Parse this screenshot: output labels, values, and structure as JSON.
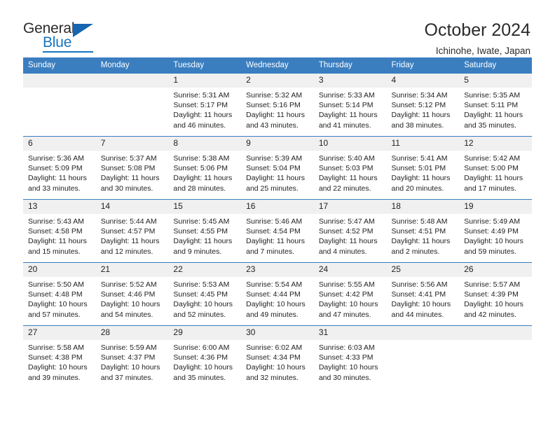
{
  "brand": {
    "name_part1": "General",
    "name_part2": "Blue",
    "accent_color": "#1874bd"
  },
  "header": {
    "title": "October 2024",
    "subtitle": "Ichinohe, Iwate, Japan"
  },
  "calendar": {
    "header_bg": "#3a7ec0",
    "daynum_bg": "#f0f0f0",
    "weekday_headers": [
      "Sunday",
      "Monday",
      "Tuesday",
      "Wednesday",
      "Thursday",
      "Friday",
      "Saturday"
    ],
    "weeks": [
      [
        {
          "day": "",
          "sunrise": "",
          "sunset": "",
          "daylight_line1": "",
          "daylight_line2": ""
        },
        {
          "day": "",
          "sunrise": "",
          "sunset": "",
          "daylight_line1": "",
          "daylight_line2": ""
        },
        {
          "day": "1",
          "sunrise": "Sunrise: 5:31 AM",
          "sunset": "Sunset: 5:17 PM",
          "daylight_line1": "Daylight: 11 hours",
          "daylight_line2": "and 46 minutes."
        },
        {
          "day": "2",
          "sunrise": "Sunrise: 5:32 AM",
          "sunset": "Sunset: 5:16 PM",
          "daylight_line1": "Daylight: 11 hours",
          "daylight_line2": "and 43 minutes."
        },
        {
          "day": "3",
          "sunrise": "Sunrise: 5:33 AM",
          "sunset": "Sunset: 5:14 PM",
          "daylight_line1": "Daylight: 11 hours",
          "daylight_line2": "and 41 minutes."
        },
        {
          "day": "4",
          "sunrise": "Sunrise: 5:34 AM",
          "sunset": "Sunset: 5:12 PM",
          "daylight_line1": "Daylight: 11 hours",
          "daylight_line2": "and 38 minutes."
        },
        {
          "day": "5",
          "sunrise": "Sunrise: 5:35 AM",
          "sunset": "Sunset: 5:11 PM",
          "daylight_line1": "Daylight: 11 hours",
          "daylight_line2": "and 35 minutes."
        }
      ],
      [
        {
          "day": "6",
          "sunrise": "Sunrise: 5:36 AM",
          "sunset": "Sunset: 5:09 PM",
          "daylight_line1": "Daylight: 11 hours",
          "daylight_line2": "and 33 minutes."
        },
        {
          "day": "7",
          "sunrise": "Sunrise: 5:37 AM",
          "sunset": "Sunset: 5:08 PM",
          "daylight_line1": "Daylight: 11 hours",
          "daylight_line2": "and 30 minutes."
        },
        {
          "day": "8",
          "sunrise": "Sunrise: 5:38 AM",
          "sunset": "Sunset: 5:06 PM",
          "daylight_line1": "Daylight: 11 hours",
          "daylight_line2": "and 28 minutes."
        },
        {
          "day": "9",
          "sunrise": "Sunrise: 5:39 AM",
          "sunset": "Sunset: 5:04 PM",
          "daylight_line1": "Daylight: 11 hours",
          "daylight_line2": "and 25 minutes."
        },
        {
          "day": "10",
          "sunrise": "Sunrise: 5:40 AM",
          "sunset": "Sunset: 5:03 PM",
          "daylight_line1": "Daylight: 11 hours",
          "daylight_line2": "and 22 minutes."
        },
        {
          "day": "11",
          "sunrise": "Sunrise: 5:41 AM",
          "sunset": "Sunset: 5:01 PM",
          "daylight_line1": "Daylight: 11 hours",
          "daylight_line2": "and 20 minutes."
        },
        {
          "day": "12",
          "sunrise": "Sunrise: 5:42 AM",
          "sunset": "Sunset: 5:00 PM",
          "daylight_line1": "Daylight: 11 hours",
          "daylight_line2": "and 17 minutes."
        }
      ],
      [
        {
          "day": "13",
          "sunrise": "Sunrise: 5:43 AM",
          "sunset": "Sunset: 4:58 PM",
          "daylight_line1": "Daylight: 11 hours",
          "daylight_line2": "and 15 minutes."
        },
        {
          "day": "14",
          "sunrise": "Sunrise: 5:44 AM",
          "sunset": "Sunset: 4:57 PM",
          "daylight_line1": "Daylight: 11 hours",
          "daylight_line2": "and 12 minutes."
        },
        {
          "day": "15",
          "sunrise": "Sunrise: 5:45 AM",
          "sunset": "Sunset: 4:55 PM",
          "daylight_line1": "Daylight: 11 hours",
          "daylight_line2": "and 9 minutes."
        },
        {
          "day": "16",
          "sunrise": "Sunrise: 5:46 AM",
          "sunset": "Sunset: 4:54 PM",
          "daylight_line1": "Daylight: 11 hours",
          "daylight_line2": "and 7 minutes."
        },
        {
          "day": "17",
          "sunrise": "Sunrise: 5:47 AM",
          "sunset": "Sunset: 4:52 PM",
          "daylight_line1": "Daylight: 11 hours",
          "daylight_line2": "and 4 minutes."
        },
        {
          "day": "18",
          "sunrise": "Sunrise: 5:48 AM",
          "sunset": "Sunset: 4:51 PM",
          "daylight_line1": "Daylight: 11 hours",
          "daylight_line2": "and 2 minutes."
        },
        {
          "day": "19",
          "sunrise": "Sunrise: 5:49 AM",
          "sunset": "Sunset: 4:49 PM",
          "daylight_line1": "Daylight: 10 hours",
          "daylight_line2": "and 59 minutes."
        }
      ],
      [
        {
          "day": "20",
          "sunrise": "Sunrise: 5:50 AM",
          "sunset": "Sunset: 4:48 PM",
          "daylight_line1": "Daylight: 10 hours",
          "daylight_line2": "and 57 minutes."
        },
        {
          "day": "21",
          "sunrise": "Sunrise: 5:52 AM",
          "sunset": "Sunset: 4:46 PM",
          "daylight_line1": "Daylight: 10 hours",
          "daylight_line2": "and 54 minutes."
        },
        {
          "day": "22",
          "sunrise": "Sunrise: 5:53 AM",
          "sunset": "Sunset: 4:45 PM",
          "daylight_line1": "Daylight: 10 hours",
          "daylight_line2": "and 52 minutes."
        },
        {
          "day": "23",
          "sunrise": "Sunrise: 5:54 AM",
          "sunset": "Sunset: 4:44 PM",
          "daylight_line1": "Daylight: 10 hours",
          "daylight_line2": "and 49 minutes."
        },
        {
          "day": "24",
          "sunrise": "Sunrise: 5:55 AM",
          "sunset": "Sunset: 4:42 PM",
          "daylight_line1": "Daylight: 10 hours",
          "daylight_line2": "and 47 minutes."
        },
        {
          "day": "25",
          "sunrise": "Sunrise: 5:56 AM",
          "sunset": "Sunset: 4:41 PM",
          "daylight_line1": "Daylight: 10 hours",
          "daylight_line2": "and 44 minutes."
        },
        {
          "day": "26",
          "sunrise": "Sunrise: 5:57 AM",
          "sunset": "Sunset: 4:39 PM",
          "daylight_line1": "Daylight: 10 hours",
          "daylight_line2": "and 42 minutes."
        }
      ],
      [
        {
          "day": "27",
          "sunrise": "Sunrise: 5:58 AM",
          "sunset": "Sunset: 4:38 PM",
          "daylight_line1": "Daylight: 10 hours",
          "daylight_line2": "and 39 minutes."
        },
        {
          "day": "28",
          "sunrise": "Sunrise: 5:59 AM",
          "sunset": "Sunset: 4:37 PM",
          "daylight_line1": "Daylight: 10 hours",
          "daylight_line2": "and 37 minutes."
        },
        {
          "day": "29",
          "sunrise": "Sunrise: 6:00 AM",
          "sunset": "Sunset: 4:36 PM",
          "daylight_line1": "Daylight: 10 hours",
          "daylight_line2": "and 35 minutes."
        },
        {
          "day": "30",
          "sunrise": "Sunrise: 6:02 AM",
          "sunset": "Sunset: 4:34 PM",
          "daylight_line1": "Daylight: 10 hours",
          "daylight_line2": "and 32 minutes."
        },
        {
          "day": "31",
          "sunrise": "Sunrise: 6:03 AM",
          "sunset": "Sunset: 4:33 PM",
          "daylight_line1": "Daylight: 10 hours",
          "daylight_line2": "and 30 minutes."
        },
        {
          "day": "",
          "sunrise": "",
          "sunset": "",
          "daylight_line1": "",
          "daylight_line2": ""
        },
        {
          "day": "",
          "sunrise": "",
          "sunset": "",
          "daylight_line1": "",
          "daylight_line2": ""
        }
      ]
    ]
  }
}
